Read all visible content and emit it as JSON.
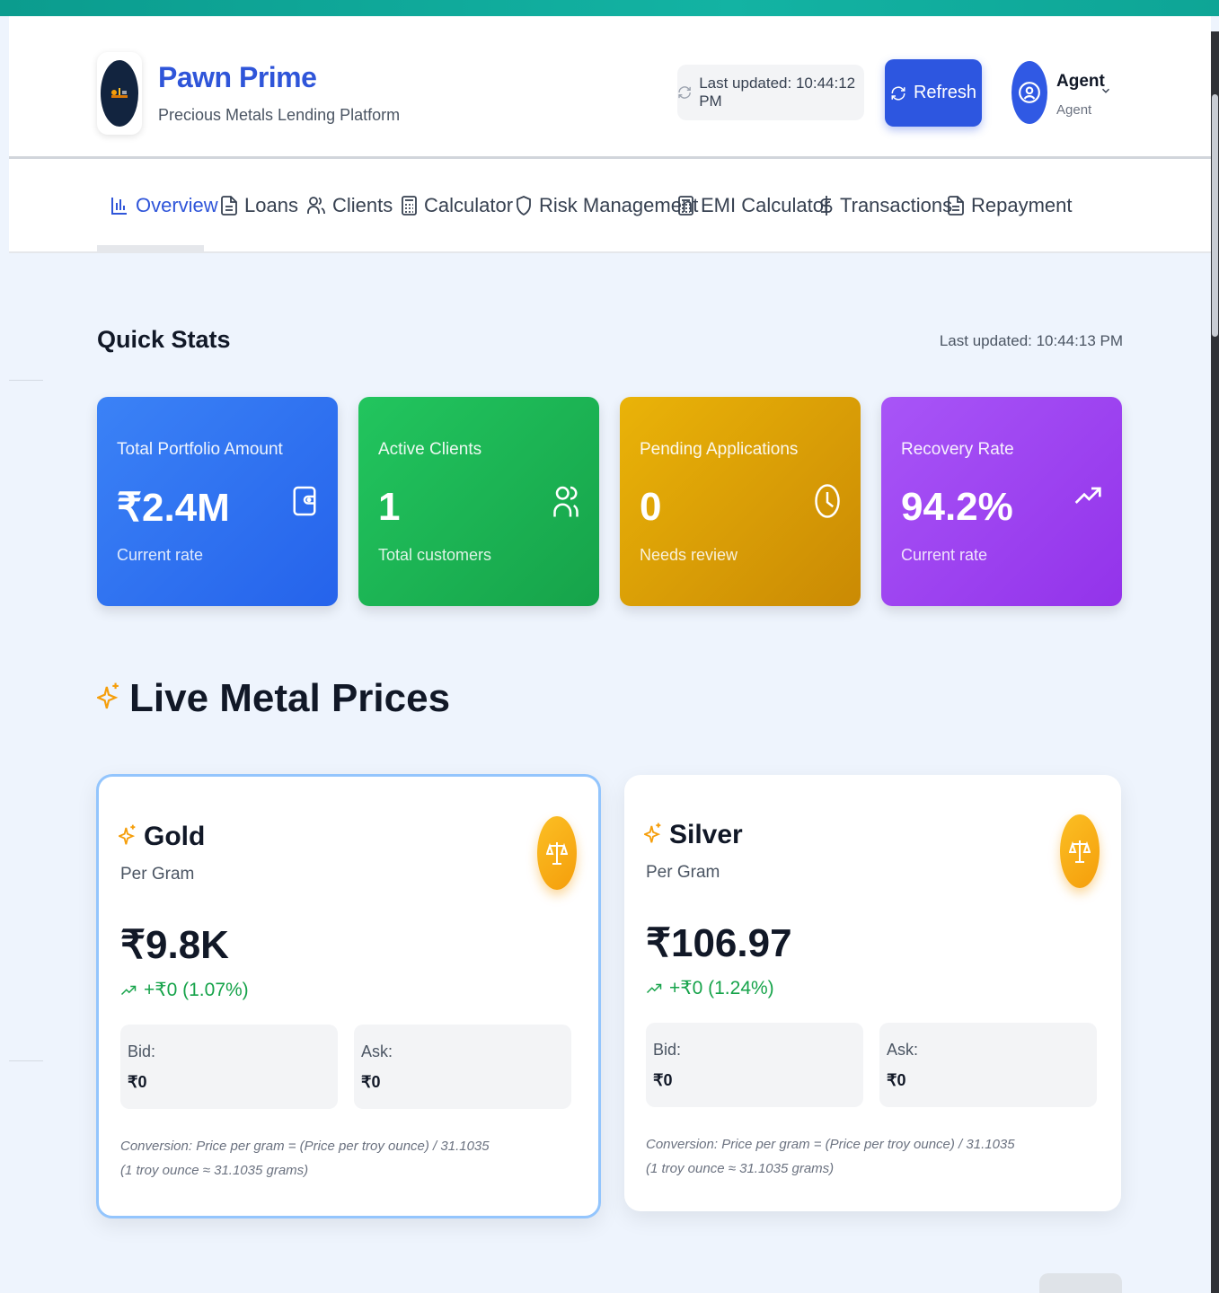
{
  "brand": {
    "title": "Pawn Prime",
    "subtitle": "Precious Metals Lending Platform",
    "logo_icon": "pawn-scale-logo"
  },
  "header": {
    "last_updated": "Last updated: 10:44:12 PM",
    "refresh_label": "Refresh",
    "user_name": "Agent",
    "user_role": "Agent",
    "primary_color": "#2d56e0"
  },
  "nav": {
    "tabs": [
      {
        "label": "Overview",
        "icon": "bar-chart-icon",
        "active": true
      },
      {
        "label": "Loans",
        "icon": "file-icon"
      },
      {
        "label": "Clients",
        "icon": "users-icon"
      },
      {
        "label": "Calculator",
        "icon": "calculator-icon"
      },
      {
        "label": "Risk Management",
        "icon": "shield-icon"
      },
      {
        "label": "EMI Calculator",
        "icon": "calculator-icon"
      },
      {
        "label": "Transactions",
        "icon": "dollar-icon"
      },
      {
        "label": "Repayment",
        "icon": "file-icon"
      }
    ]
  },
  "quick_stats": {
    "title": "Quick Stats",
    "last_updated": "Last updated: 10:44:13 PM",
    "cards": [
      {
        "label": "Total Portfolio Amount",
        "value": "₹2.4M",
        "sub": "Current rate",
        "icon": "wallet-icon",
        "color": "#3b82f6"
      },
      {
        "label": "Active Clients",
        "value": "1",
        "sub": "Total customers",
        "icon": "users-icon",
        "color": "#22c55e"
      },
      {
        "label": "Pending Applications",
        "value": "0",
        "sub": "Needs review",
        "icon": "clock-icon",
        "color": "#eab308"
      },
      {
        "label": "Recovery Rate",
        "value": "94.2%",
        "sub": "Current rate",
        "icon": "trending-up-icon",
        "color": "#a855f7"
      }
    ]
  },
  "live_prices": {
    "title": "Live Metal Prices",
    "metals": [
      {
        "name": "Gold",
        "per": "Per Gram",
        "price": "₹9.8K",
        "change": "+₹0 (1.07%)",
        "bid_label": "Bid:",
        "bid": "₹0",
        "ask_label": "Ask:",
        "ask": "₹0",
        "note_1": "Conversion: Price per gram = (Price per troy ounce) / 31.1035",
        "note_2": "(1 troy ounce ≈ 31.1035 grams)"
      },
      {
        "name": "Silver",
        "per": "Per Gram",
        "price": "₹106.97",
        "change": "+₹0 (1.24%)",
        "bid_label": "Bid:",
        "bid": "₹0",
        "ask_label": "Ask:",
        "ask": "₹0",
        "note_1": "Conversion: Price per gram = (Price per troy ounce) / 31.1035",
        "note_2": "(1 troy ounce ≈ 31.1035 grams)"
      }
    ]
  }
}
